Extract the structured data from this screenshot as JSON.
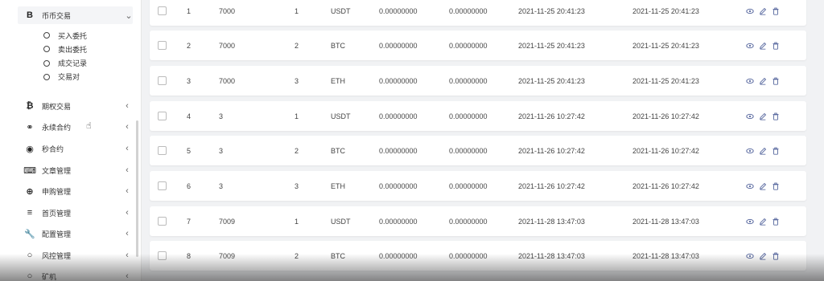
{
  "sidebar": {
    "active_group": {
      "icon": "bitcoin-b-icon",
      "icon_glyph": "B",
      "label": "币币交易",
      "arrow": "⌄"
    },
    "sub_items": [
      "买入委托",
      "卖出委托",
      "成交记录",
      "交易对"
    ],
    "groups": [
      {
        "icon": "bitcoin-icon",
        "glyph": "₿",
        "label": "期权交易",
        "arrow": "‹"
      },
      {
        "icon": "link-icon",
        "glyph": "⚭",
        "label": "永续合约",
        "arrow": "‹"
      },
      {
        "icon": "target-icon",
        "glyph": "◉",
        "label": "秒合约",
        "arrow": "‹"
      },
      {
        "icon": "keyboard-icon",
        "glyph": "⌨",
        "label": "文章管理",
        "arrow": "‹"
      },
      {
        "icon": "lifebuoy-icon",
        "glyph": "⊕",
        "label": "申购管理",
        "arrow": "‹"
      },
      {
        "icon": "list-icon",
        "glyph": "≡",
        "label": "首页管理",
        "arrow": "‹"
      },
      {
        "icon": "wrench-icon",
        "glyph": "🔧",
        "label": "配置管理",
        "arrow": "‹"
      },
      {
        "icon": "circle-icon",
        "glyph": "○",
        "label": "风控管理",
        "arrow": "‹"
      },
      {
        "icon": "circle-icon",
        "glyph": "○",
        "label": "矿机",
        "arrow": "‹"
      }
    ]
  },
  "table": {
    "rows": [
      {
        "id": "1",
        "uid": "7000",
        "type": "1",
        "coin": "USDT",
        "amount1": "0.00000000",
        "amount2": "0.00000000",
        "created": "2021-11-25 20:41:23",
        "updated": "2021-11-25 20:41:23"
      },
      {
        "id": "2",
        "uid": "7000",
        "type": "2",
        "coin": "BTC",
        "amount1": "0.00000000",
        "amount2": "0.00000000",
        "created": "2021-11-25 20:41:23",
        "updated": "2021-11-25 20:41:23"
      },
      {
        "id": "3",
        "uid": "7000",
        "type": "3",
        "coin": "ETH",
        "amount1": "0.00000000",
        "amount2": "0.00000000",
        "created": "2021-11-25 20:41:23",
        "updated": "2021-11-25 20:41:23"
      },
      {
        "id": "4",
        "uid": "3",
        "type": "1",
        "coin": "USDT",
        "amount1": "0.00000000",
        "amount2": "0.00000000",
        "created": "2021-11-26 10:27:42",
        "updated": "2021-11-26 10:27:42"
      },
      {
        "id": "5",
        "uid": "3",
        "type": "2",
        "coin": "BTC",
        "amount1": "0.00000000",
        "amount2": "0.00000000",
        "created": "2021-11-26 10:27:42",
        "updated": "2021-11-26 10:27:42"
      },
      {
        "id": "6",
        "uid": "3",
        "type": "3",
        "coin": "ETH",
        "amount1": "0.00000000",
        "amount2": "0.00000000",
        "created": "2021-11-26 10:27:42",
        "updated": "2021-11-26 10:27:42"
      },
      {
        "id": "7",
        "uid": "7009",
        "type": "1",
        "coin": "USDT",
        "amount1": "0.00000000",
        "amount2": "0.00000000",
        "created": "2021-11-28 13:47:03",
        "updated": "2021-11-28 13:47:03"
      },
      {
        "id": "8",
        "uid": "7009",
        "type": "2",
        "coin": "BTC",
        "amount1": "0.00000000",
        "amount2": "0.00000000",
        "created": "2021-11-28 13:47:03",
        "updated": "2021-11-28 13:47:03"
      }
    ],
    "row_actions": [
      "eye-icon",
      "edit-icon",
      "trash-icon"
    ]
  },
  "colors": {
    "action_icon": "#5a6aa0",
    "sidebar_active_bg": "#f4f5f7",
    "page_bg": "#f1f2f4"
  }
}
